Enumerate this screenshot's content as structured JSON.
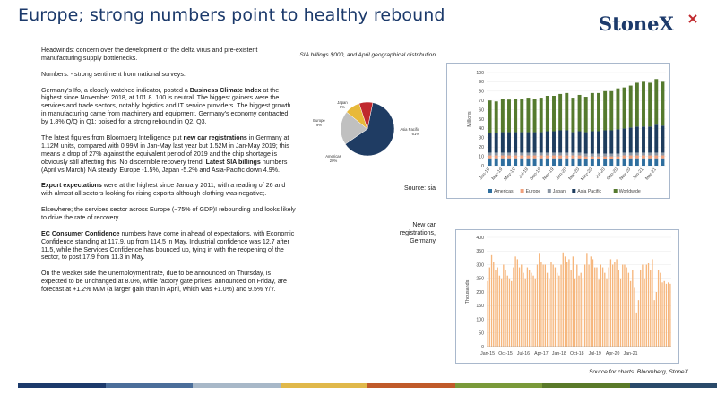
{
  "header": {
    "title": "Europe; strong numbers point to healthy rebound",
    "logo_text": "StoneX"
  },
  "body": {
    "p1": "Headwinds: concern over the development of the delta virus and pre-existent manufacturing supply bottlenecks.",
    "p2": "Numbers: - strong sentiment from national surveys.",
    "p3_a": "Germany's Ifo, a closely-watched indicator, posted a ",
    "p3_b": "Business Climate Index",
    "p3_c": " at the highest since November 2018, at 101.8. 100 is neutral. The biggest gainers were the services and trade sectors, notably logistics and IT service providers. The biggest growth in manufacturing came from machinery and equipment. Germany's economy contracted by 1.8% Q/Q in Q1; poised for a strong rebound in Q2, Q3.",
    "p4_a": "The latest figures from Bloomberg Intelligence put ",
    "p4_b": "new car registrations",
    "p4_c": " in Germany at 1.12M units, compared with 0.99M in Jan-May last year but 1.52M in Jan-May 2019; this means a drop of 27% against the equivalent period of 2019 and the chip shortage is obviously still affecting this. No discernible recovery trend. ",
    "p4_d": "Latest SIA billings",
    "p4_e": " numbers (April vs March) NA steady, Europe -1.5%, Japan -5.2% and Asia-Pacific down 4.9%.",
    "p5_a": "Export expectations",
    "p5_b": " were at the highest since January 2011, with a reading of 26 and with almost all sectors looking for rising exports although clothing was negative;.",
    "p6": "Elsewhere; the services sector across Europe (~75% of GDP)I rebounding and looks likely to drive the rate of recovery.",
    "p7_a": "EC Consumer Confidence",
    "p7_b": " numbers have come in ahead of expectations, with Economic Confidence standing at 117.9, up from 114.5 in May. Industrial confidence was 12.7 after 11.5, while the Services Confidence has bounced up, tying in with the reopening of the sector, to post 17.9 from 11.3 in May.",
    "p8": "On the weaker side the unemployment rate, due to be announced on Thursday, is expected to be unchanged at 8.0%, while factory gate prices, announced on Friday, are forecast at +1.2% M/M (a larger gain than in April, which was +1.0%) and 9.5% Y/Y."
  },
  "captions": {
    "pie_caption": "SIA billings $000, and April geographical distribution",
    "source1": "Source: sia",
    "cars_caption": "New car registrations, Germany",
    "source2": "Source for charts: Bloomberg, StoneX"
  },
  "colors": {
    "title": "#1c3a6b",
    "americas": "#2e6e9e",
    "europe": "#f0a07c",
    "japan": "#8a95a3",
    "asia_pacific": "#1e3d5e",
    "worldwide": "#557a2e",
    "pie_americas": "#c0c0c0",
    "pie_europe": "#e8b93a",
    "pie_japan": "#c0282d",
    "pie_asia": "#1f3c63",
    "cars_bar": "#f6b67c",
    "stripe": [
      "#1c3a6b",
      "#4b6e9a",
      "#a8b8c8",
      "#e0b84a",
      "#c05a2a",
      "#7a9a3a",
      "#5a7a2a",
      "#2a4a6a"
    ]
  },
  "chart_data": [
    {
      "type": "pie",
      "title": "",
      "slices": [
        {
          "label": "Asia Pacific",
          "pct": "61%",
          "value": 61
        },
        {
          "label": "Americas",
          "pct": "20%",
          "value": 20
        },
        {
          "label": "Europe",
          "pct": "9%",
          "value": 9
        },
        {
          "label": "Japan",
          "pct": "8%",
          "value": 8
        }
      ]
    },
    {
      "type": "bar",
      "stacked": true,
      "ylabel": "Millions",
      "ylim": [
        0,
        100
      ],
      "yticks": [
        "0",
        "10",
        "20",
        "30",
        "40",
        "50",
        "60",
        "70",
        "80",
        "90",
        "100"
      ],
      "xticks": [
        "Jan-19",
        "Mar-19",
        "May-19",
        "Jul-19",
        "Sep-19",
        "Nov-19",
        "Jan-20",
        "Mar-20",
        "May-20",
        "Jul-20",
        "Sep-20",
        "Nov-20",
        "Jan-21",
        "Mar-21"
      ],
      "categories": [
        "Jan-19",
        "Feb-19",
        "Mar-19",
        "Apr-19",
        "May-19",
        "Jun-19",
        "Jul-19",
        "Aug-19",
        "Sep-19",
        "Oct-19",
        "Nov-19",
        "Dec-19",
        "Jan-20",
        "Feb-20",
        "Mar-20",
        "Apr-20",
        "May-20",
        "Jun-20",
        "Jul-20",
        "Aug-20",
        "Sep-20",
        "Oct-20",
        "Nov-20",
        "Dec-20",
        "Jan-21",
        "Feb-21",
        "Mar-21",
        "Apr-21"
      ],
      "series": [
        {
          "name": "Americas",
          "values": [
            8,
            8,
            8,
            8,
            8,
            8,
            8,
            8,
            8,
            8,
            8,
            8,
            8,
            8,
            8,
            7,
            7,
            7,
            7,
            7,
            7,
            8,
            8,
            8,
            8,
            8,
            8,
            8
          ]
        },
        {
          "name": "Europe",
          "values": [
            3,
            3,
            3,
            3,
            3,
            3,
            3,
            3,
            3,
            3,
            3,
            3,
            3,
            3,
            3,
            3,
            3,
            3,
            3,
            3,
            3,
            3,
            3,
            3,
            3,
            3,
            3,
            3
          ]
        },
        {
          "name": "Japan",
          "values": [
            3,
            3,
            3,
            3,
            3,
            3,
            3,
            3,
            3,
            3,
            3,
            3,
            3,
            3,
            3,
            3,
            3,
            3,
            3,
            3,
            3,
            3,
            3,
            3,
            3,
            3,
            3,
            3
          ]
        },
        {
          "name": "Asia Pacific",
          "values": [
            21,
            21,
            22,
            22,
            22,
            22,
            22,
            22,
            22,
            23,
            23,
            24,
            24,
            22,
            23,
            23,
            24,
            24,
            25,
            25,
            26,
            26,
            27,
            28,
            28,
            28,
            30,
            29
          ]
        },
        {
          "name": "Worldwide",
          "values": [
            35,
            34,
            36,
            35,
            36,
            36,
            37,
            36,
            37,
            38,
            38,
            39,
            40,
            37,
            39,
            38,
            41,
            41,
            42,
            42,
            44,
            44,
            45,
            47,
            48,
            47,
            49,
            47
          ]
        }
      ],
      "legend": [
        "Americas",
        "Europe",
        "Japan",
        "Asia Pacific",
        "Worldwide"
      ],
      "legend_position": "bottom"
    },
    {
      "type": "bar",
      "ylabel": "Thousands",
      "ylim": [
        0,
        400
      ],
      "yticks": [
        "0",
        "50",
        "100",
        "150",
        "200",
        "250",
        "300",
        "350",
        "400"
      ],
      "xticks": [
        "Jan-15",
        "Oct-15",
        "Jul-16",
        "Apr-17",
        "Jan-18",
        "Oct-18",
        "Jul-19",
        "Apr-20",
        "Jan-21"
      ],
      "values": [
        240,
        290,
        335,
        310,
        280,
        290,
        260,
        250,
        300,
        280,
        260,
        250,
        240,
        290,
        330,
        320,
        290,
        300,
        270,
        250,
        290,
        280,
        270,
        260,
        250,
        300,
        340,
        310,
        300,
        300,
        270,
        250,
        310,
        300,
        290,
        270,
        260,
        300,
        345,
        330,
        310,
        320,
        280,
        330,
        250,
        300,
        260,
        270,
        250,
        300,
        340,
        300,
        330,
        320,
        290,
        290,
        245,
        300,
        290,
        270,
        250,
        290,
        320,
        300,
        310,
        320,
        280,
        250,
        300,
        300,
        290,
        270,
        240,
        280,
        215,
        125,
        170,
        280,
        300,
        250,
        300,
        305,
        280,
        320,
        170,
        200,
        280,
        270,
        235,
        240,
        230,
        235,
        230
      ]
    }
  ]
}
